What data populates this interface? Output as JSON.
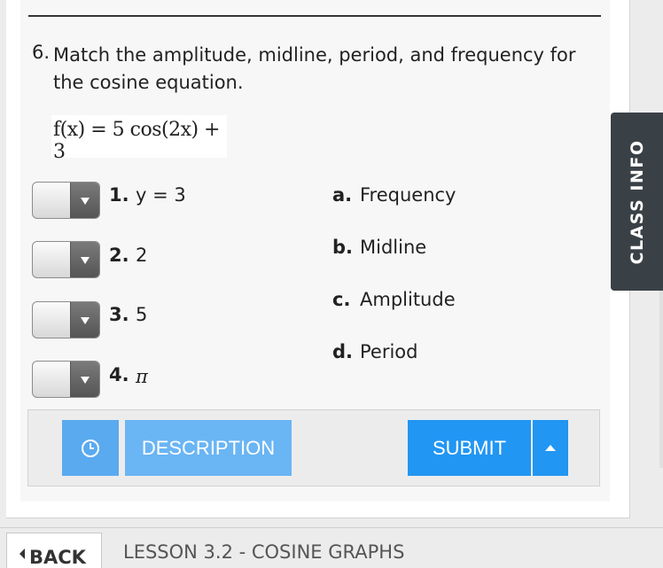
{
  "question": {
    "number": "6.",
    "text": "Match the amplitude, midline, period, and frequency for the cosine equation.",
    "equation": "f(x) = 5 cos(2x) + 3"
  },
  "items": [
    {
      "num": "1.",
      "value": "y = 3",
      "selected": ""
    },
    {
      "num": "2.",
      "value": "2",
      "selected": ""
    },
    {
      "num": "3.",
      "value": "5",
      "selected": ""
    },
    {
      "num": "4.",
      "value": "π",
      "selected": ""
    }
  ],
  "options": [
    {
      "letter": "a.",
      "text": "Frequency"
    },
    {
      "letter": "b.",
      "text": "Midline"
    },
    {
      "letter": "c.",
      "text": "Amplitude"
    },
    {
      "letter": "d.",
      "text": "Period"
    }
  ],
  "toolbar": {
    "description_label": "DESCRIPTION",
    "submit_label": "SUBMIT",
    "clock_icon": "clock-icon",
    "more_icon": "caret-up-icon"
  },
  "side_tab": {
    "label": "CLASS INFO"
  },
  "footer": {
    "back_label": "BACK",
    "lesson_title": "LESSON 3.2 - COSINE GRAPHS"
  },
  "colors": {
    "accent": "#2196f3",
    "accent_light": "#6ab5f4",
    "side_tab_bg": "#3a4146"
  }
}
